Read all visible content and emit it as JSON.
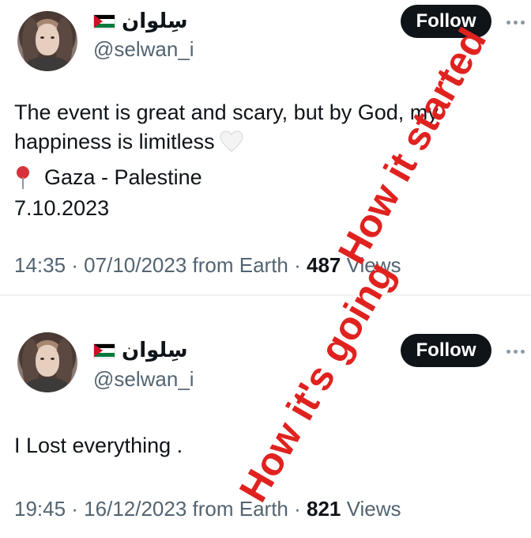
{
  "tweets": [
    {
      "display_name": "سِلوان",
      "handle": "@selwan_i",
      "follow_label": "Follow",
      "text_line1": "The event is great and scary, but by God, my",
      "text_line2": "happiness is limitless",
      "location": "Gaza - Palestine",
      "date": "7.10.2023",
      "meta_prefix": "14:35 · 07/10/2023 from Earth · ",
      "views_count": "487",
      "views_label": " Views"
    },
    {
      "display_name": "سِلوان",
      "handle": "@selwan_i",
      "follow_label": "Follow",
      "text_line1": "I Lost everything .",
      "meta_prefix": "19:45 · 16/12/2023 from Earth · ",
      "views_count": "821",
      "views_label": " Views"
    }
  ],
  "overlays": {
    "started": "How it started",
    "going": "How it's going"
  },
  "icons": {
    "flag": "palestine-flag-icon",
    "heart": "white-heart-icon",
    "pin": "round-pushpin-icon",
    "more": "more-dots-icon"
  },
  "colors": {
    "follow_bg": "#0f1419",
    "secondary_text": "#536471",
    "overlay_red": "#e0221f"
  }
}
